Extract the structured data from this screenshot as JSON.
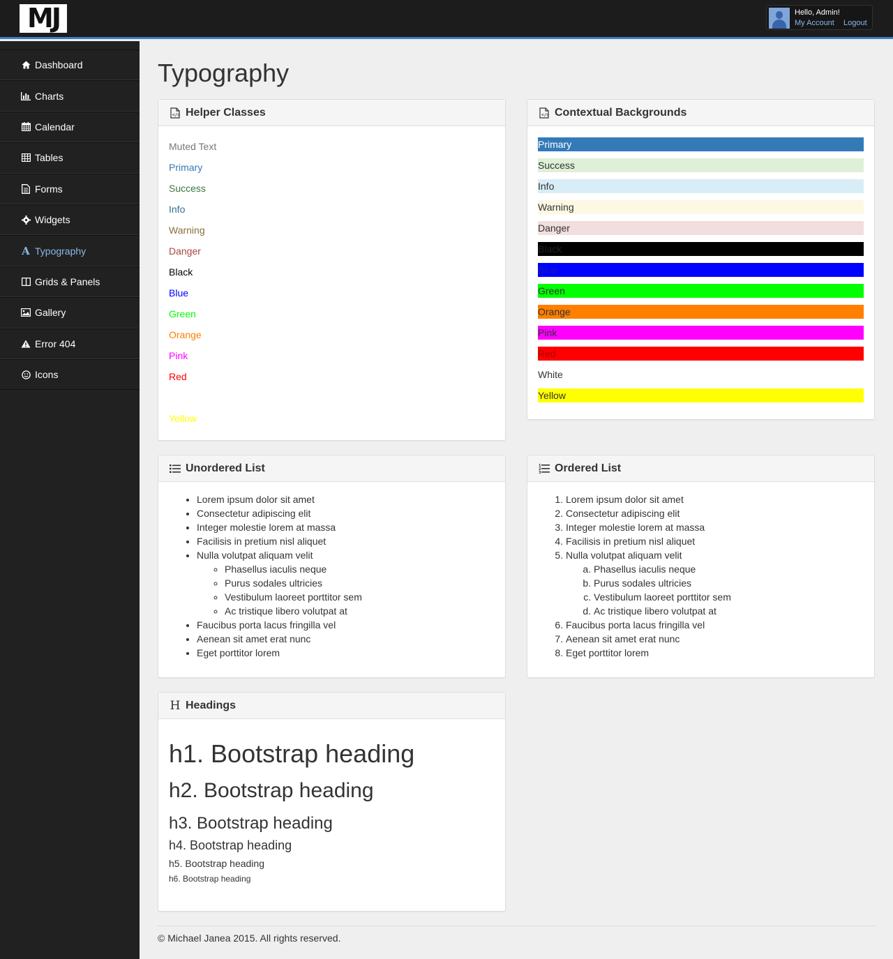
{
  "brand": {
    "logo": "MJ"
  },
  "user": {
    "greeting": "Hello, Admin!",
    "account_link": "My Account",
    "logout_link": "Logout"
  },
  "sidebar": {
    "items": [
      {
        "label": "Dashboard",
        "icon": "home-icon"
      },
      {
        "label": "Charts",
        "icon": "bar-chart-icon"
      },
      {
        "label": "Calendar",
        "icon": "calendar-icon"
      },
      {
        "label": "Tables",
        "icon": "table-icon"
      },
      {
        "label": "Forms",
        "icon": "form-icon"
      },
      {
        "label": "Widgets",
        "icon": "gear-icon"
      },
      {
        "label": "Typography",
        "icon": "font-icon",
        "active": true
      },
      {
        "label": "Grids & Panels",
        "icon": "columns-icon"
      },
      {
        "label": "Gallery",
        "icon": "image-icon"
      },
      {
        "label": "Error 404",
        "icon": "warning-icon"
      },
      {
        "label": "Icons",
        "icon": "smile-icon"
      }
    ]
  },
  "page": {
    "title": "Typography"
  },
  "helper": {
    "title": "Helper Classes",
    "items": [
      {
        "text": "Muted Text",
        "color": "#777777"
      },
      {
        "text": "Primary",
        "color": "#337ab7"
      },
      {
        "text": "Success",
        "color": "#3c763d"
      },
      {
        "text": "Info",
        "color": "#31708f"
      },
      {
        "text": "Warning",
        "color": "#8a6d3b"
      },
      {
        "text": "Danger",
        "color": "#a94442"
      },
      {
        "text": "Black",
        "color": "#000000"
      },
      {
        "text": "Blue",
        "color": "#0000ff"
      },
      {
        "text": "Green",
        "color": "#00ff00"
      },
      {
        "text": "Orange",
        "color": "#ff7f00"
      },
      {
        "text": "Pink",
        "color": "#ff00ff"
      },
      {
        "text": "Red",
        "color": "#ff0000"
      },
      {
        "text": "White",
        "color": "#ffffff"
      },
      {
        "text": "Yellow",
        "color": "#ffff00"
      }
    ]
  },
  "contextual": {
    "title": "Contextual Backgrounds",
    "items": [
      {
        "text": "Primary",
        "bg": "#337ab7",
        "color": "#ffffff"
      },
      {
        "text": "Success",
        "bg": "#dff0d8",
        "color": "#333333"
      },
      {
        "text": "Info",
        "bg": "#d9edf7",
        "color": "#333333"
      },
      {
        "text": "Warning",
        "bg": "#fcf8e3",
        "color": "#333333"
      },
      {
        "text": "Danger",
        "bg": "#f2dede",
        "color": "#333333"
      },
      {
        "text": "Black",
        "bg": "#000000",
        "color": "#222222"
      },
      {
        "text": "Blue",
        "bg": "#0000ff",
        "color": "#1a1aaa"
      },
      {
        "text": "Green",
        "bg": "#00ff00",
        "color": "#333333"
      },
      {
        "text": "Orange",
        "bg": "#ff7f00",
        "color": "#333333"
      },
      {
        "text": "Pink",
        "bg": "#ff00ff",
        "color": "#333333"
      },
      {
        "text": "Red",
        "bg": "#ff0000",
        "color": "#aa0000"
      },
      {
        "text": "White",
        "bg": "#ffffff",
        "color": "#333333"
      },
      {
        "text": "Yellow",
        "bg": "#ffff00",
        "color": "#333333"
      }
    ]
  },
  "unordered": {
    "title": "Unordered List",
    "items": [
      "Lorem ipsum dolor sit amet",
      "Consectetur adipiscing elit",
      "Integer molestie lorem at massa",
      "Facilisis in pretium nisl aliquet",
      "Nulla volutpat aliquam velit"
    ],
    "sub_items": [
      "Phasellus iaculis neque",
      "Purus sodales ultricies",
      "Vestibulum laoreet porttitor sem",
      "Ac tristique libero volutpat at"
    ],
    "tail_items": [
      "Faucibus porta lacus fringilla vel",
      "Aenean sit amet erat nunc",
      "Eget porttitor lorem"
    ]
  },
  "ordered": {
    "title": "Ordered List",
    "items": [
      "Lorem ipsum dolor sit amet",
      "Consectetur adipiscing elit",
      "Integer molestie lorem at massa",
      "Facilisis in pretium nisl aliquet",
      "Nulla volutpat aliquam velit"
    ],
    "sub_items": [
      "Phasellus iaculis neque",
      "Purus sodales ultricies",
      "Vestibulum laoreet porttitor sem",
      "Ac tristique libero volutpat at"
    ],
    "tail_items": [
      "Faucibus porta lacus fringilla vel",
      "Aenean sit amet erat nunc",
      "Eget porttitor lorem"
    ]
  },
  "headings": {
    "title": "Headings",
    "h1": "h1. Bootstrap heading",
    "h2": "h2. Bootstrap heading",
    "h3": "h3. Bootstrap heading",
    "h4": "h4. Bootstrap heading",
    "h5": "h5. Bootstrap heading",
    "h6": "h6. Bootstrap heading"
  },
  "footer": {
    "text": "© Michael Janea 2015. All rights reserved."
  },
  "colors": {
    "accent": "#3a7fc1",
    "sidebar_bg": "#212121",
    "topbar_bg": "#1c1c1c",
    "active_nav": "#8ab8e8"
  }
}
